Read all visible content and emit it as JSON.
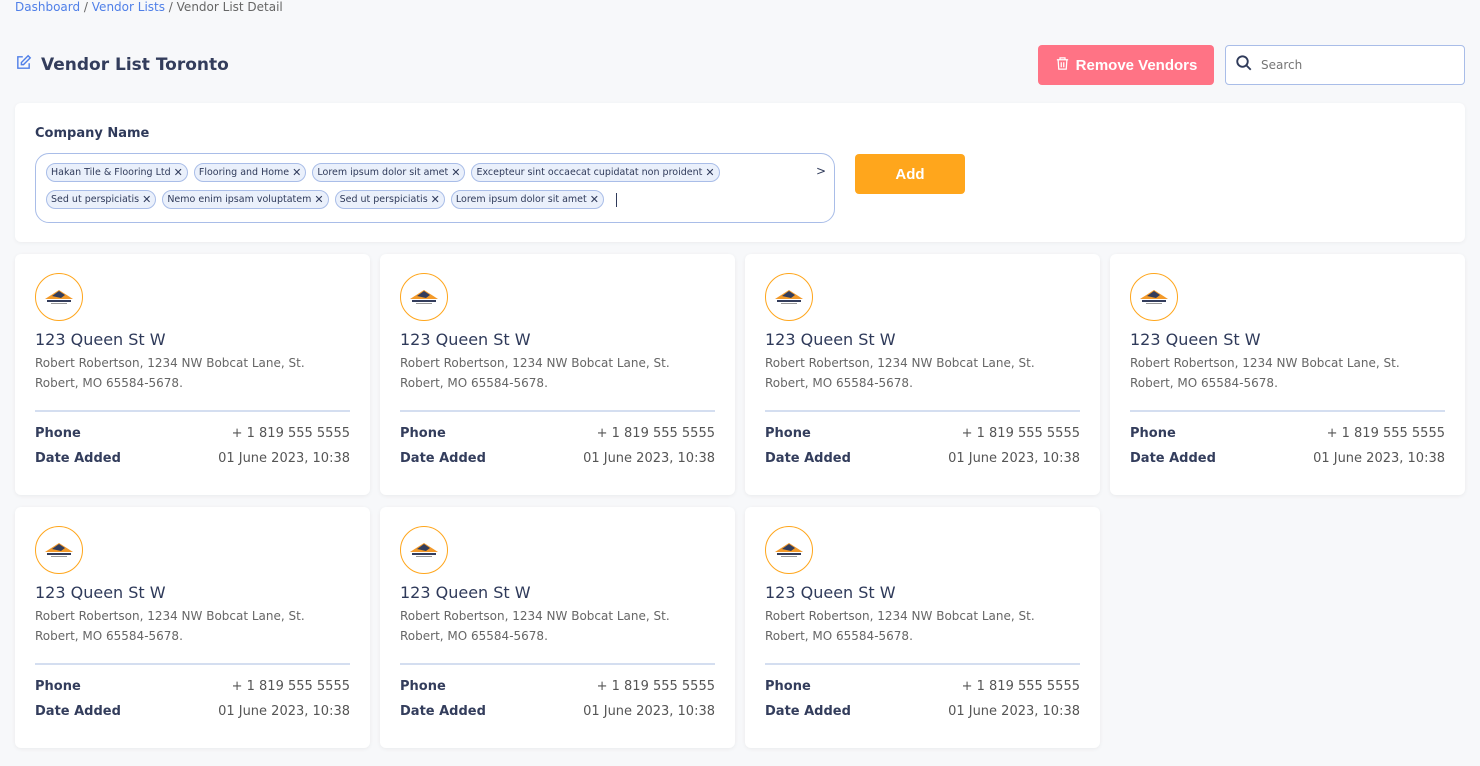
{
  "breadcrumb": [
    {
      "label": "Dashboard"
    },
    {
      "label": "Vendor Lists"
    },
    {
      "label": "Vendor List Detail"
    }
  ],
  "header": {
    "title": "Vendor List Toronto",
    "remove_label": "Remove Vendors",
    "search_placeholder": "Search"
  },
  "filter": {
    "label": "Company Name",
    "add_label": "Add",
    "tags": [
      "Hakan Tile & Flooring Ltd",
      "Flooring and Home",
      "Lorem ipsum dolor sit amet",
      "Excepteur sint occaecat cupidatat non proident",
      "Sed ut perspiciatis",
      "Nemo enim ipsam voluptatem",
      "Sed ut perspiciatis",
      "Lorem ipsum dolor sit amet"
    ]
  },
  "labels": {
    "phone": "Phone",
    "date": "Date Added"
  },
  "vendors": [
    {
      "name": "123 Queen St W",
      "address": "Robert Robertson, 1234 NW Bobcat Lane, St. Robert, MO 65584-5678.",
      "phone": "+ 1 819 555 5555",
      "date": "01 June 2023, 10:38"
    },
    {
      "name": "123 Queen St W",
      "address": "Robert Robertson, 1234 NW Bobcat Lane, St. Robert, MO 65584-5678.",
      "phone": "+ 1 819 555 5555",
      "date": "01 June 2023, 10:38"
    },
    {
      "name": "123 Queen St W",
      "address": "Robert Robertson, 1234 NW Bobcat Lane, St. Robert, MO 65584-5678.",
      "phone": "+ 1 819 555 5555",
      "date": "01 June 2023, 10:38"
    },
    {
      "name": "123 Queen St W",
      "address": "Robert Robertson, 1234 NW Bobcat Lane, St. Robert, MO 65584-5678.",
      "phone": "+ 1 819 555 5555",
      "date": "01 June 2023, 10:38"
    },
    {
      "name": "123 Queen St W",
      "address": "Robert Robertson, 1234 NW Bobcat Lane, St. Robert, MO 65584-5678.",
      "phone": "+ 1 819 555 5555",
      "date": "01 June 2023, 10:38"
    },
    {
      "name": "123 Queen St W",
      "address": "Robert Robertson, 1234 NW Bobcat Lane, St. Robert, MO 65584-5678.",
      "phone": "+ 1 819 555 5555",
      "date": "01 June 2023, 10:38"
    },
    {
      "name": "123 Queen St W",
      "address": "Robert Robertson, 1234 NW Bobcat Lane, St. Robert, MO 65584-5678.",
      "phone": "+ 1 819 555 5555",
      "date": "01 June 2023, 10:38"
    }
  ],
  "colors": {
    "accent": "#4f7fe8",
    "danger": "#ff7385",
    "warning": "#ffa61c"
  }
}
